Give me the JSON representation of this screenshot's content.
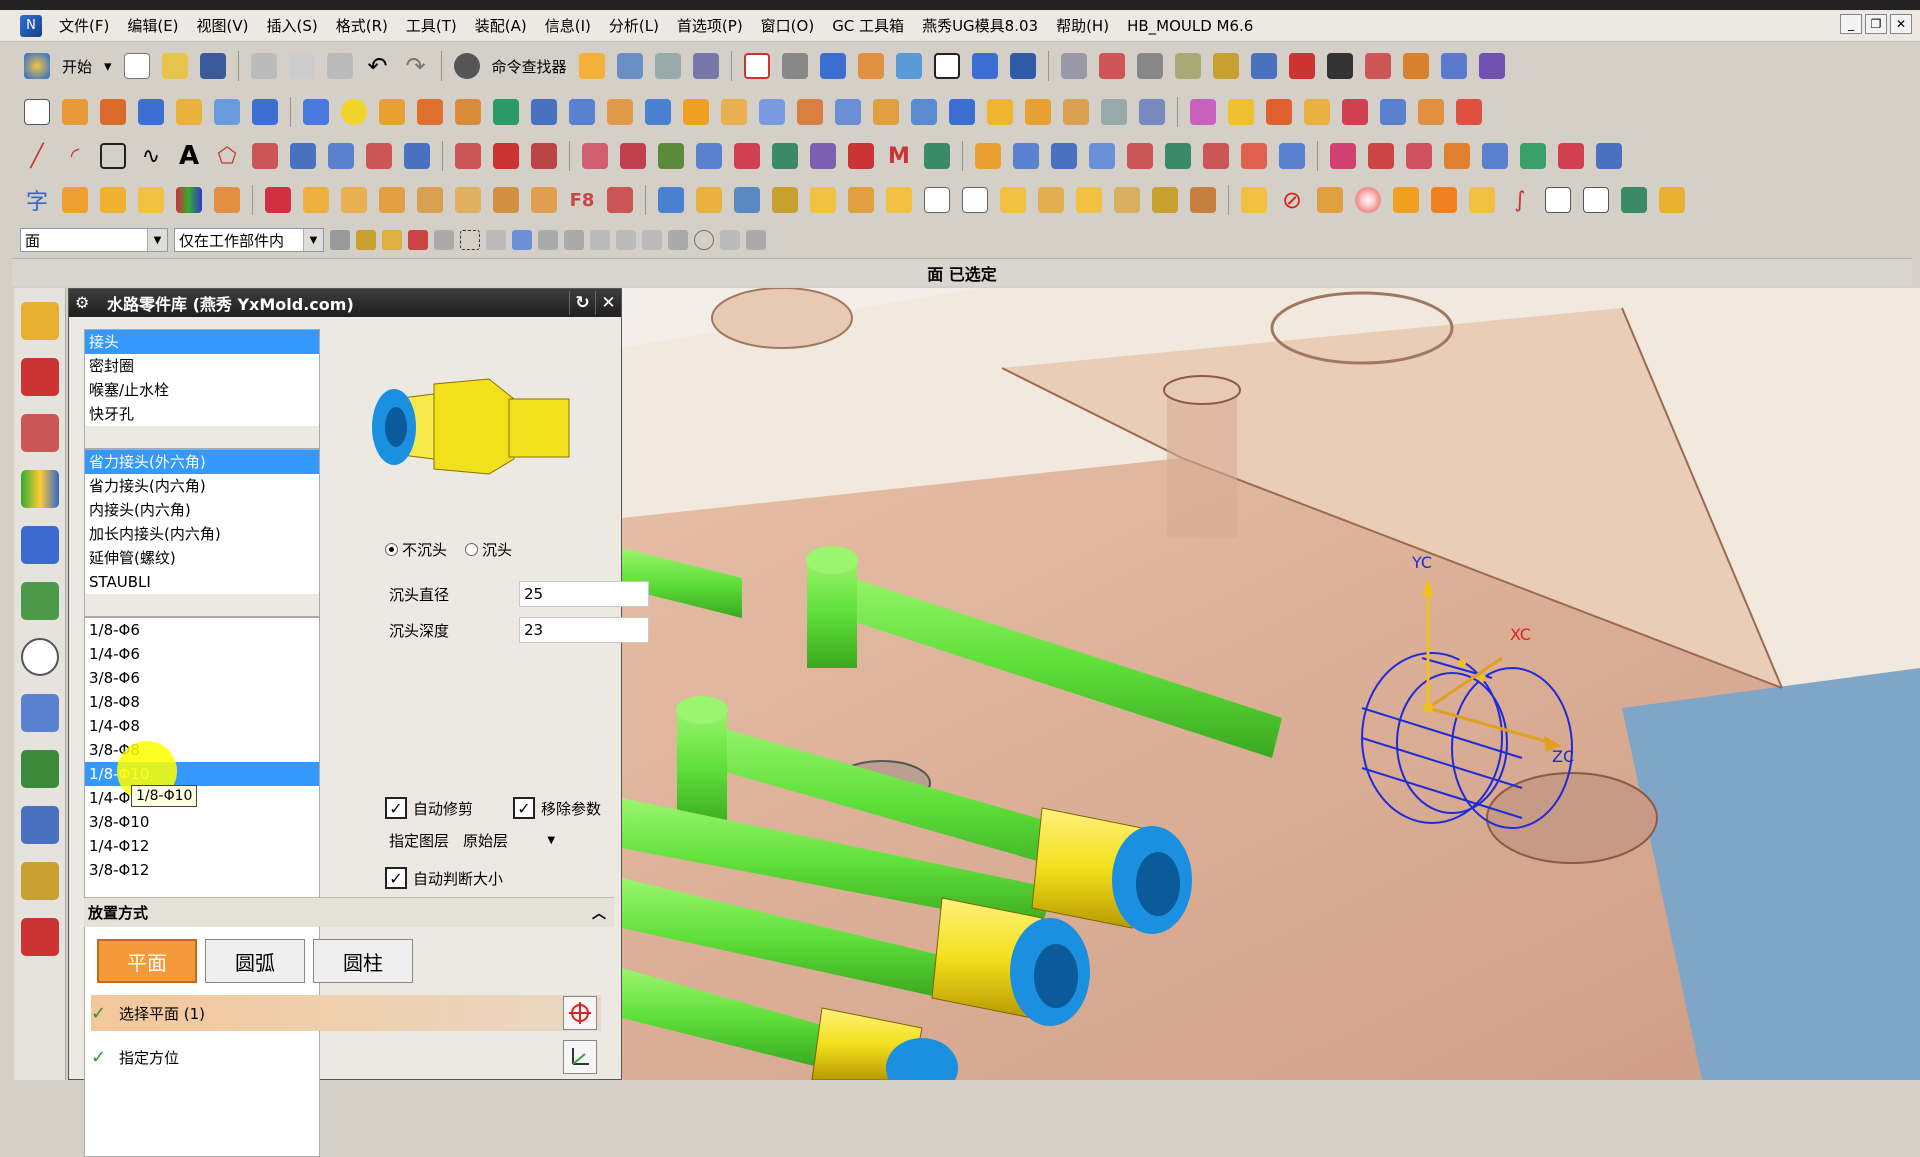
{
  "menu": [
    "文件(F)",
    "编辑(E)",
    "视图(V)",
    "插入(S)",
    "格式(R)",
    "工具(T)",
    "装配(A)",
    "信息(I)",
    "分析(L)",
    "首选项(P)",
    "窗口(O)",
    "GC 工具箱",
    "燕秀UG模具8.03",
    "帮助(H)",
    "HB_MOULD M6.6"
  ],
  "toolbar": {
    "start_label": "开始",
    "command_finder_label": "命令查找器"
  },
  "filter": {
    "type_value": "面",
    "scope_value": "仅在工作部件内"
  },
  "cue": "面 已选定",
  "dialog": {
    "title": "水路零件库 (燕秀 YxMold.com)",
    "list1": [
      "接头",
      "密封圈",
      "喉塞/止水栓",
      "快牙孔"
    ],
    "list2": [
      "省力接头(外六角)",
      "省力接头(内六角)",
      "内接头(内六角)",
      "加长内接头(内六角)",
      "延伸管(螺纹)",
      "STAUBLI"
    ],
    "list3": [
      "1/8-Φ6",
      "1/4-Φ6",
      "3/8-Φ6",
      "1/8-Φ8",
      "1/4-Φ8",
      "3/8-Φ8",
      "1/8-Φ10",
      "1/4-Φ10",
      "3/8-Φ10",
      "1/4-Φ12",
      "3/8-Φ12"
    ],
    "radio_no_counterbore": "不沉头",
    "radio_counterbore": "沉头",
    "cb_diameter_label": "沉头直径",
    "cb_diameter_value": "25",
    "cb_depth_label": "沉头深度",
    "cb_depth_value": "23",
    "auto_trim_label": "自动修剪",
    "remove_params_label": "移除参数",
    "layer_label": "指定图层",
    "layer_value": "原始层",
    "auto_size_label": "自动判断大小",
    "placement_label": "放置方式",
    "placement_tabs": [
      "平面",
      "圆弧",
      "圆柱"
    ],
    "step_select_plane": "选择平面 (1)",
    "step_orient": "指定方位",
    "tooltip": "1/8-Φ10"
  },
  "viewport": {
    "axis_yc": "YC",
    "axis_xc": "XC",
    "axis_zc": "ZC"
  },
  "colors": {
    "selection": "#3399ff",
    "active_tab": "#f59a3a",
    "pipe": "#5fe03a",
    "fitting": "#f3e01c",
    "fitting_ring": "#1b8fe0"
  }
}
